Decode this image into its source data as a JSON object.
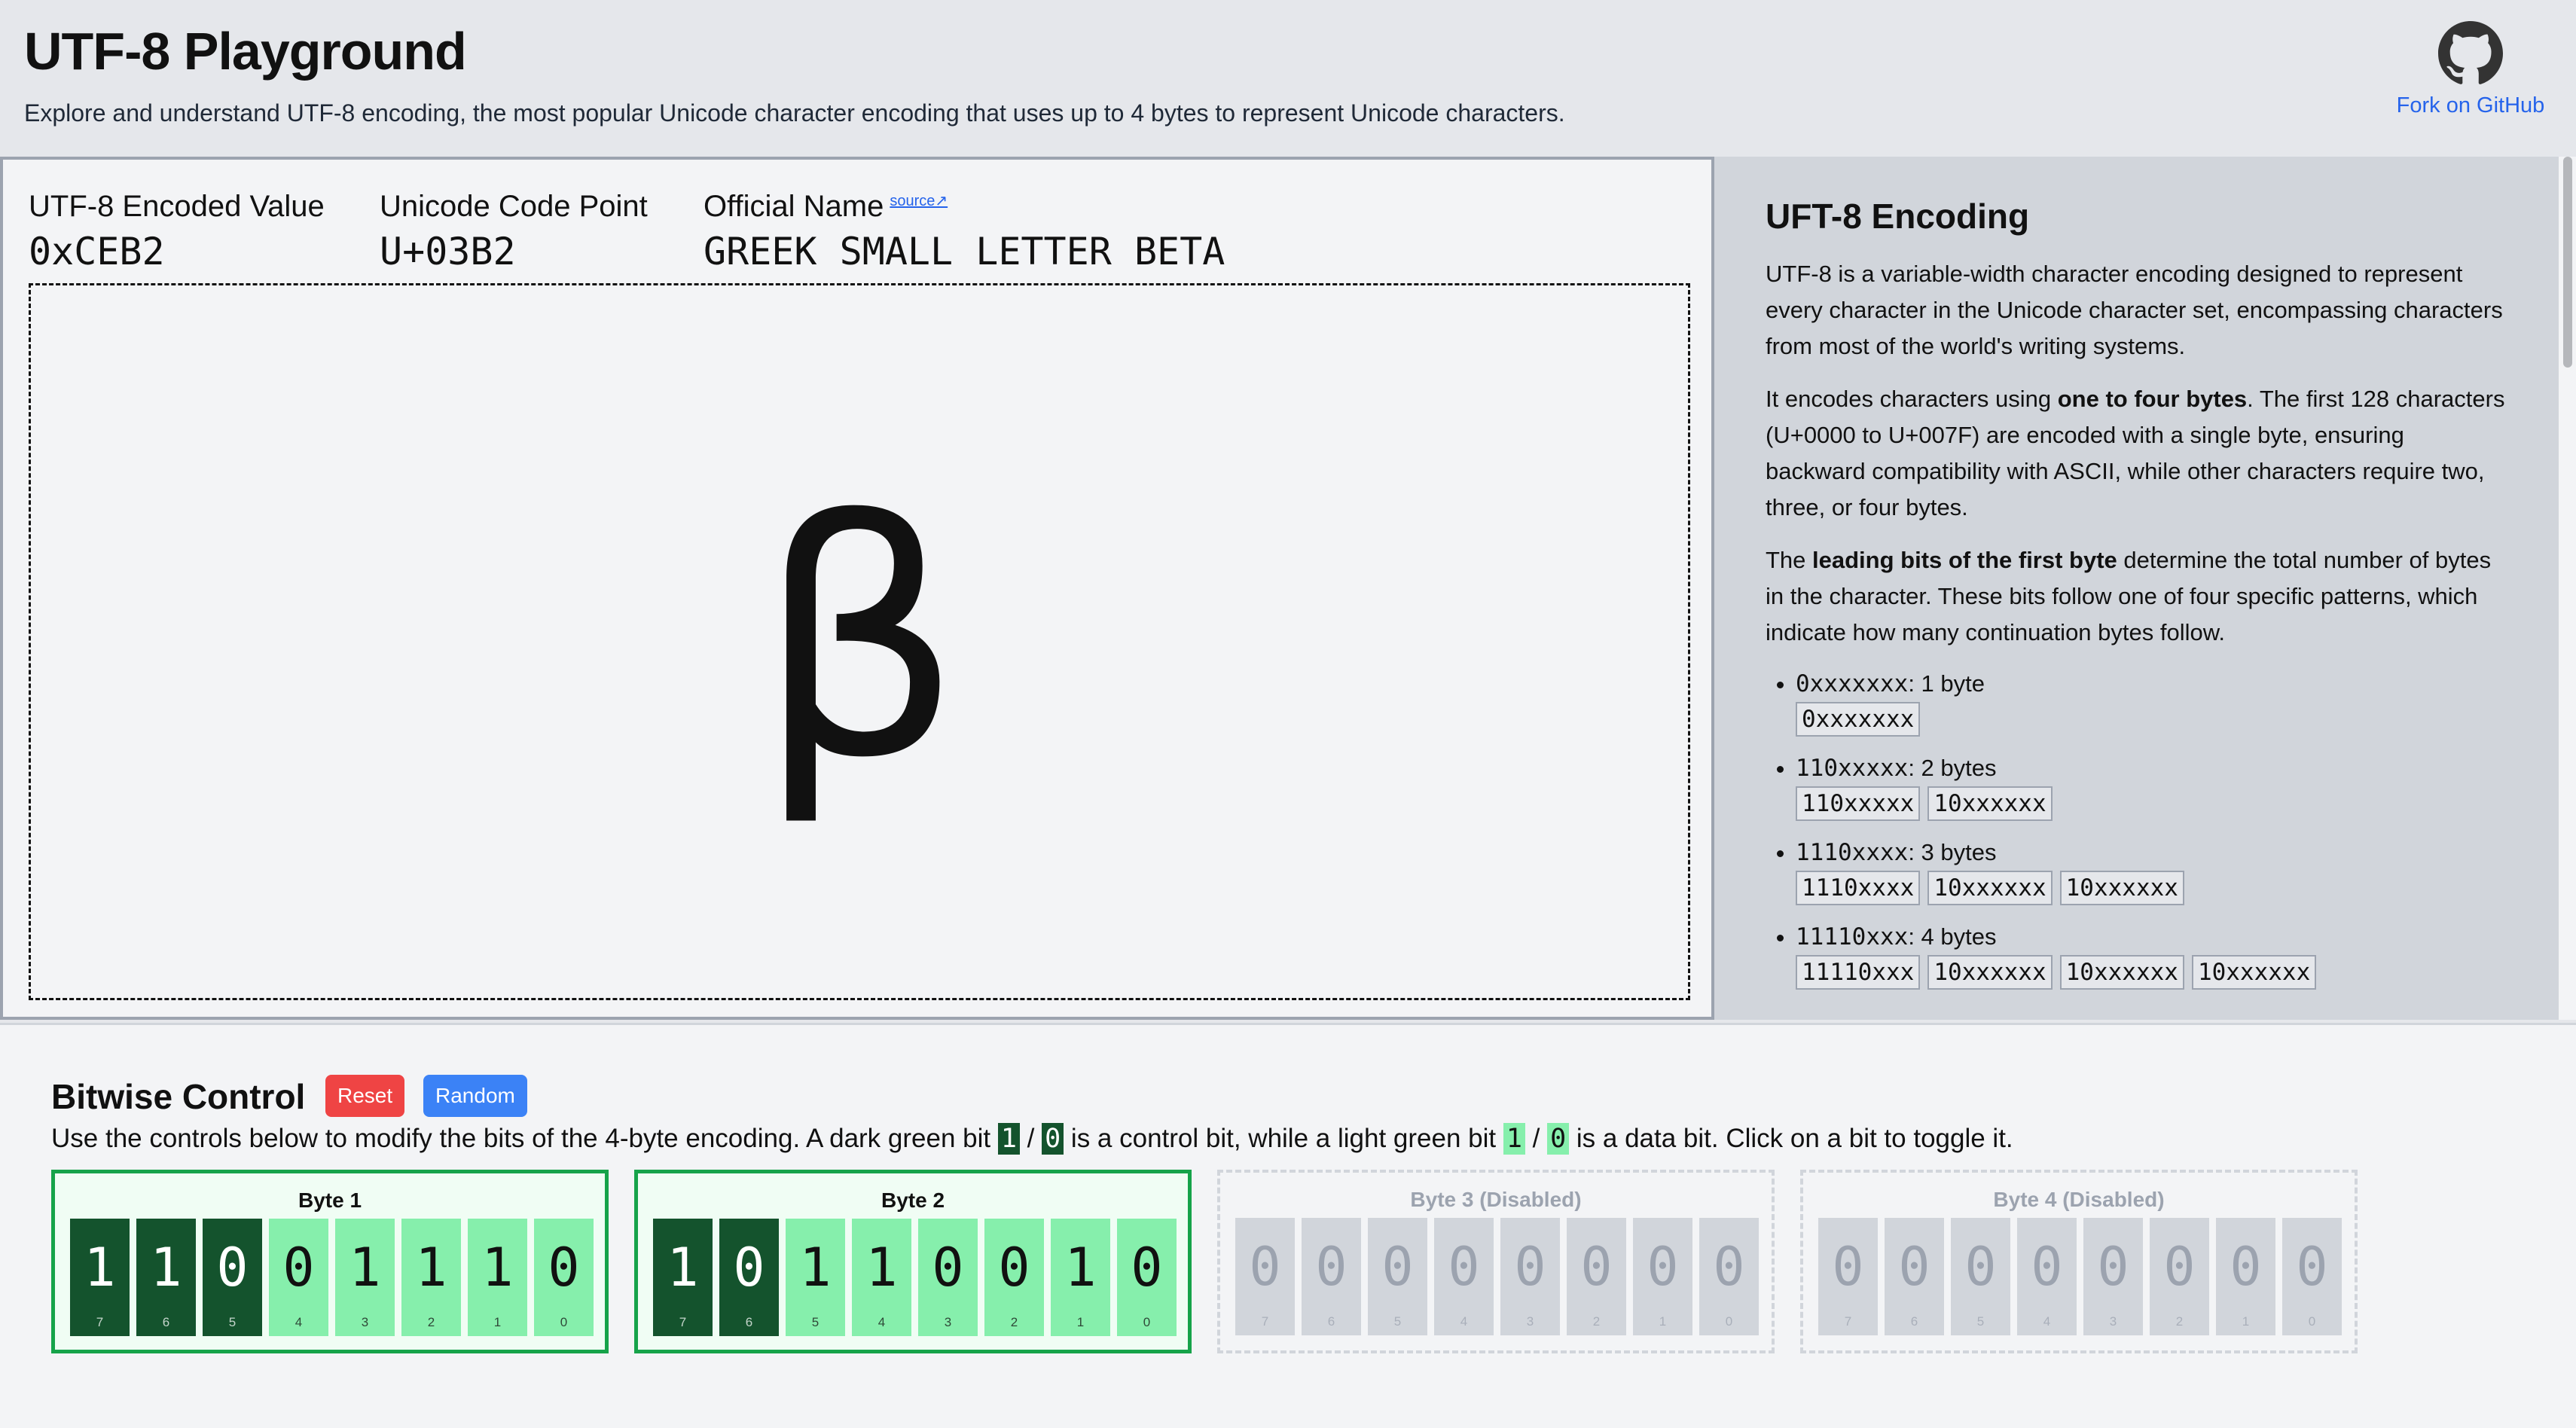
{
  "header": {
    "title": "UTF-8 Playground",
    "subtitle": "Explore and understand UTF-8 encoding, the most popular Unicode character encoding that uses up to 4 bytes to represent Unicode characters.",
    "github_label": "Fork on GitHub",
    "github_icon": "github-icon"
  },
  "display": {
    "encoded_label": "UTF-8 Encoded Value",
    "encoded_value": "0xCEB2",
    "codepoint_label": "Unicode Code Point",
    "codepoint_value": "U+03B2",
    "name_label": "Official Name",
    "source_label": "source↗",
    "name_value": "GREEK SMALL LETTER BETA",
    "glyph": "β"
  },
  "explain": {
    "title": "UFT-8 Encoding",
    "p1": "UTF-8 is a variable-width character encoding designed to represent every character in the Unicode character set, encompassing characters from most of the world's writing systems.",
    "p2_pre": "It encodes characters using ",
    "p2_bold": "one to four bytes",
    "p2_post": ". The first 128 characters (U+0000 to U+007F) are encoded with a single byte, ensuring backward compatibility with ASCII, while other characters require two, three, or four bytes.",
    "p3_pre": "The ",
    "p3_bold": "leading bits of the first byte",
    "p3_post": " determine the total number of bytes in the character. These bits follow one of four specific patterns, which indicate how many continuation bytes follow.",
    "patterns": [
      {
        "code": "0xxxxxxx",
        "desc": ": 1 byte",
        "boxes": [
          "0xxxxxxx"
        ]
      },
      {
        "code": "110xxxxx",
        "desc": ": 2 bytes",
        "boxes": [
          "110xxxxx",
          "10xxxxxx"
        ]
      },
      {
        "code": "1110xxxx",
        "desc": ": 3 bytes",
        "boxes": [
          "1110xxxx",
          "10xxxxxx",
          "10xxxxxx"
        ]
      },
      {
        "code": "11110xxx",
        "desc": ": 4 bytes",
        "boxes": [
          "11110xxx",
          "10xxxxxx",
          "10xxxxxx",
          "10xxxxxx"
        ]
      }
    ]
  },
  "bitwise": {
    "title": "Bitwise Control",
    "reset_label": "Reset",
    "random_label": "Random",
    "desc_1": "Use the controls below to modify the bits of the 4-byte encoding. A dark green bit ",
    "legend_one": "1",
    "legend_sep": " / ",
    "legend_zero": "0",
    "desc_2": " is a control bit, while a light green bit ",
    "desc_3": " is a data bit. Click on a bit to toggle it.",
    "bytes": [
      {
        "label": "Byte 1",
        "enabled": true,
        "bits": [
          "1",
          "1",
          "0",
          "0",
          "1",
          "1",
          "1",
          "0"
        ],
        "control_count": 3
      },
      {
        "label": "Byte 2",
        "enabled": true,
        "bits": [
          "1",
          "0",
          "1",
          "1",
          "0",
          "0",
          "1",
          "0"
        ],
        "control_count": 2
      },
      {
        "label": "Byte 3 (Disabled)",
        "enabled": false,
        "bits": [
          "0",
          "0",
          "0",
          "0",
          "0",
          "0",
          "0",
          "0"
        ],
        "control_count": 0
      },
      {
        "label": "Byte 4 (Disabled)",
        "enabled": false,
        "bits": [
          "0",
          "0",
          "0",
          "0",
          "0",
          "0",
          "0",
          "0"
        ],
        "control_count": 0
      }
    ],
    "bit_indexes": [
      "7",
      "6",
      "5",
      "4",
      "3",
      "2",
      "1",
      "0"
    ]
  },
  "colors": {
    "control_bit": "#14532d",
    "data_bit": "#86efac",
    "reset": "#ef4444",
    "random": "#3b82f6",
    "link": "#2563eb"
  }
}
